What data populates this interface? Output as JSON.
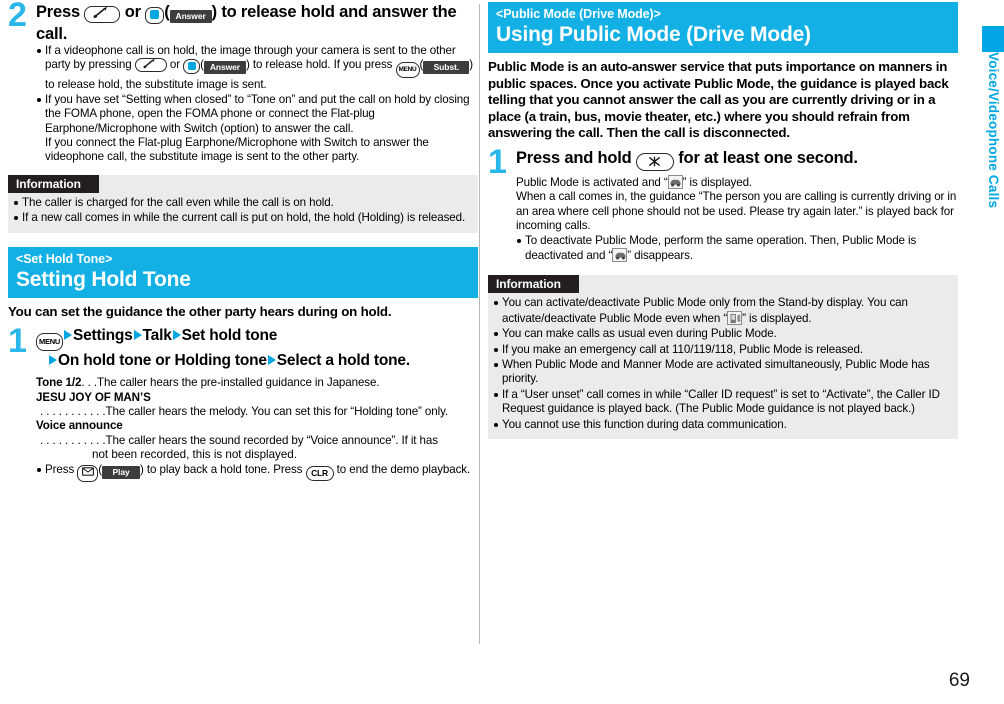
{
  "page": {
    "number": "69",
    "edge_tab_label": "Voice/Videophone Calls"
  },
  "left_column": {
    "step2": {
      "number": "2",
      "heading_part1": "Press",
      "heading_or": "or",
      "heading_part2": "to release hold and answer the call.",
      "key_call": "call-key",
      "key_center": "center-select-key",
      "softkey_answer": "Answer",
      "bullets": [
        {
          "seg1": "If a videophone call is on hold, the image through your camera is sent to the other party by pressing",
          "or": "or",
          "softkey1": "Answer",
          "seg2": "to release hold. If you press",
          "softkey2": "Subst.",
          "seg3": "to release hold, the substitute image is sent."
        },
        {
          "text": "If you have set “Setting when closed” to “Tone on” and put the call on hold by closing the FOMA phone, open the FOMA phone or connect the Flat-plug Earphone/Microphone with Switch (option) to answer the call.",
          "continuation": "If you connect the Flat-plug Earphone/Microphone with Switch to answer the videophone call, the substitute image is sent to the other party."
        }
      ]
    },
    "information": {
      "tag": "Information",
      "items": [
        "The caller is charged for the call even while the call is on hold.",
        "If a new call comes in while the current call is put on hold, the hold (Holding) is released."
      ]
    },
    "section": {
      "kicker": "<Set Hold Tone>",
      "title": "Setting Hold Tone",
      "intro": "You can set the guidance the other party hears during on hold.",
      "step1": {
        "number": "1",
        "key_menu": "MENU",
        "line1_items": [
          "Settings",
          "Talk",
          "Set hold tone"
        ],
        "line2_items": [
          "On hold tone or Holding tone",
          "Select a hold tone."
        ]
      },
      "definitions": [
        {
          "term": "Tone 1/2",
          "dots": ". . .",
          "desc": "The caller hears the pre-installed guidance in Japanese."
        },
        {
          "term": "JESU JOY OF MAN’S",
          "dots": ". . . . . . . . . . .",
          "desc": "The caller hears the melody. You can set this for “Holding tone” only."
        },
        {
          "term": "Voice announce",
          "dots": ". . . . . . . . . . .",
          "desc": "The caller hears the sound recorded by “Voice announce”. If it has",
          "desc_cont": "not been recorded, this is not displayed."
        }
      ],
      "play_bullet": {
        "seg1": "Press",
        "softkey": "Play",
        "seg2": "to play back a hold tone. Press",
        "key_clr": "CLR",
        "seg3": "to end the demo playback."
      }
    }
  },
  "right_column": {
    "section": {
      "kicker": "<Public Mode (Drive Mode)>",
      "title": "Using Public Mode (Drive Mode)",
      "intro": "Public Mode is an auto-answer service that puts importance on manners in public spaces. Once you activate Public Mode, the guidance is played back telling that you cannot answer the call as you are currently driving or in a place (a train, bus, movie theater, etc.) where you should refrain from answering the call. Then the call is disconnected.",
      "step1": {
        "number": "1",
        "heading_part1": "Press and hold",
        "heading_part2": "for at least one second.",
        "key_star": "star-key",
        "line1_a": "Public Mode is activated and “",
        "line1_b": "” is displayed.",
        "line2": "When a call comes in, the guidance “The person you are calling is currently driving or in an area where cell phone should not be used. Please try again later.” is played back for incoming calls.",
        "bullet_a": "To deactivate Public Mode, perform the same operation. Then, Public Mode is deactivated and “",
        "bullet_b": "” disappears."
      }
    },
    "information": {
      "tag": "Information",
      "items": [
        {
          "seg1": "You can activate/deactivate Public Mode only from the Stand-by display. You can activate/deactivate Public Mode even when “",
          "icon": "manner-mode-icon",
          "seg2": "” is displayed."
        },
        {
          "text": "You can make calls as usual even during Public Mode."
        },
        {
          "text": "If you make an emergency call at 110/119/118, Public Mode is released."
        },
        {
          "text": "When Public Mode and Manner Mode are activated simultaneously, Public Mode has priority."
        },
        {
          "text": "If a “User unset” call comes in while “Caller ID request” is set to “Activate”, the Caller ID Request guidance is played back. (The Public Mode guidance is not played back.)"
        },
        {
          "text": "You cannot use this function during data communication."
        }
      ]
    }
  },
  "colors": {
    "accent_cyan": "#13b0e6",
    "step_number_cyan": "#29b6e8",
    "info_bg": "#ebebeb",
    "info_tag_bg": "#231f20",
    "softkey_bg": "#3d3d3d"
  }
}
